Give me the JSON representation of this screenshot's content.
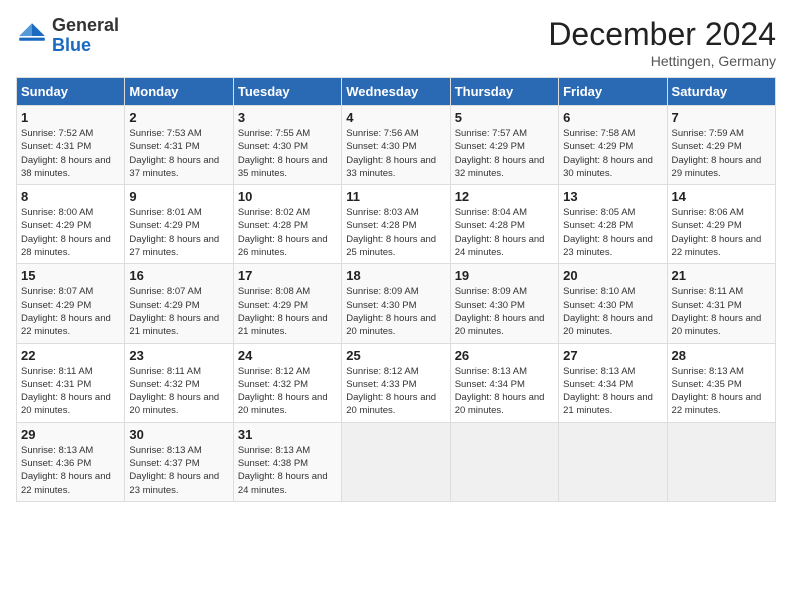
{
  "header": {
    "logo_line1": "General",
    "logo_line2": "Blue",
    "month_title": "December 2024",
    "location": "Hettingen, Germany"
  },
  "days_of_week": [
    "Sunday",
    "Monday",
    "Tuesday",
    "Wednesday",
    "Thursday",
    "Friday",
    "Saturday"
  ],
  "weeks": [
    [
      {
        "day": "1",
        "sunrise": "7:52 AM",
        "sunset": "4:31 PM",
        "daylight": "8 hours and 38 minutes."
      },
      {
        "day": "2",
        "sunrise": "7:53 AM",
        "sunset": "4:31 PM",
        "daylight": "8 hours and 37 minutes."
      },
      {
        "day": "3",
        "sunrise": "7:55 AM",
        "sunset": "4:30 PM",
        "daylight": "8 hours and 35 minutes."
      },
      {
        "day": "4",
        "sunrise": "7:56 AM",
        "sunset": "4:30 PM",
        "daylight": "8 hours and 33 minutes."
      },
      {
        "day": "5",
        "sunrise": "7:57 AM",
        "sunset": "4:29 PM",
        "daylight": "8 hours and 32 minutes."
      },
      {
        "day": "6",
        "sunrise": "7:58 AM",
        "sunset": "4:29 PM",
        "daylight": "8 hours and 30 minutes."
      },
      {
        "day": "7",
        "sunrise": "7:59 AM",
        "sunset": "4:29 PM",
        "daylight": "8 hours and 29 minutes."
      }
    ],
    [
      {
        "day": "8",
        "sunrise": "8:00 AM",
        "sunset": "4:29 PM",
        "daylight": "8 hours and 28 minutes."
      },
      {
        "day": "9",
        "sunrise": "8:01 AM",
        "sunset": "4:29 PM",
        "daylight": "8 hours and 27 minutes."
      },
      {
        "day": "10",
        "sunrise": "8:02 AM",
        "sunset": "4:28 PM",
        "daylight": "8 hours and 26 minutes."
      },
      {
        "day": "11",
        "sunrise": "8:03 AM",
        "sunset": "4:28 PM",
        "daylight": "8 hours and 25 minutes."
      },
      {
        "day": "12",
        "sunrise": "8:04 AM",
        "sunset": "4:28 PM",
        "daylight": "8 hours and 24 minutes."
      },
      {
        "day": "13",
        "sunrise": "8:05 AM",
        "sunset": "4:28 PM",
        "daylight": "8 hours and 23 minutes."
      },
      {
        "day": "14",
        "sunrise": "8:06 AM",
        "sunset": "4:29 PM",
        "daylight": "8 hours and 22 minutes."
      }
    ],
    [
      {
        "day": "15",
        "sunrise": "8:07 AM",
        "sunset": "4:29 PM",
        "daylight": "8 hours and 22 minutes."
      },
      {
        "day": "16",
        "sunrise": "8:07 AM",
        "sunset": "4:29 PM",
        "daylight": "8 hours and 21 minutes."
      },
      {
        "day": "17",
        "sunrise": "8:08 AM",
        "sunset": "4:29 PM",
        "daylight": "8 hours and 21 minutes."
      },
      {
        "day": "18",
        "sunrise": "8:09 AM",
        "sunset": "4:30 PM",
        "daylight": "8 hours and 20 minutes."
      },
      {
        "day": "19",
        "sunrise": "8:09 AM",
        "sunset": "4:30 PM",
        "daylight": "8 hours and 20 minutes."
      },
      {
        "day": "20",
        "sunrise": "8:10 AM",
        "sunset": "4:30 PM",
        "daylight": "8 hours and 20 minutes."
      },
      {
        "day": "21",
        "sunrise": "8:11 AM",
        "sunset": "4:31 PM",
        "daylight": "8 hours and 20 minutes."
      }
    ],
    [
      {
        "day": "22",
        "sunrise": "8:11 AM",
        "sunset": "4:31 PM",
        "daylight": "8 hours and 20 minutes."
      },
      {
        "day": "23",
        "sunrise": "8:11 AM",
        "sunset": "4:32 PM",
        "daylight": "8 hours and 20 minutes."
      },
      {
        "day": "24",
        "sunrise": "8:12 AM",
        "sunset": "4:32 PM",
        "daylight": "8 hours and 20 minutes."
      },
      {
        "day": "25",
        "sunrise": "8:12 AM",
        "sunset": "4:33 PM",
        "daylight": "8 hours and 20 minutes."
      },
      {
        "day": "26",
        "sunrise": "8:13 AM",
        "sunset": "4:34 PM",
        "daylight": "8 hours and 20 minutes."
      },
      {
        "day": "27",
        "sunrise": "8:13 AM",
        "sunset": "4:34 PM",
        "daylight": "8 hours and 21 minutes."
      },
      {
        "day": "28",
        "sunrise": "8:13 AM",
        "sunset": "4:35 PM",
        "daylight": "8 hours and 22 minutes."
      }
    ],
    [
      {
        "day": "29",
        "sunrise": "8:13 AM",
        "sunset": "4:36 PM",
        "daylight": "8 hours and 22 minutes."
      },
      {
        "day": "30",
        "sunrise": "8:13 AM",
        "sunset": "4:37 PM",
        "daylight": "8 hours and 23 minutes."
      },
      {
        "day": "31",
        "sunrise": "8:13 AM",
        "sunset": "4:38 PM",
        "daylight": "8 hours and 24 minutes."
      },
      null,
      null,
      null,
      null
    ]
  ]
}
